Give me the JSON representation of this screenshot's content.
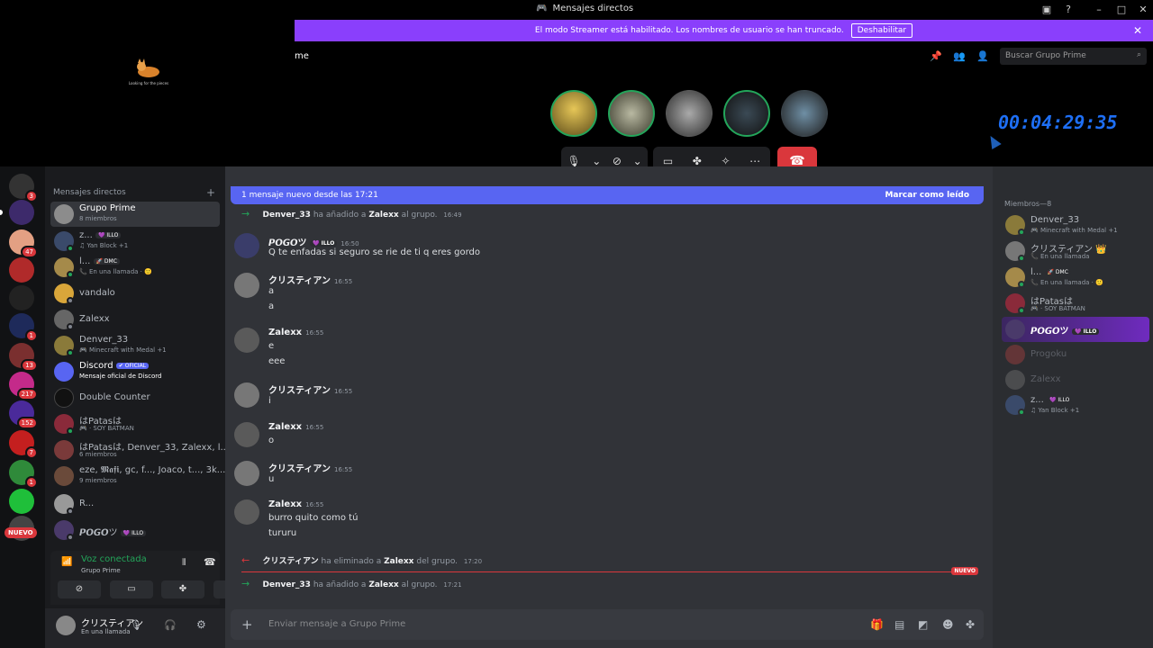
{
  "window": {
    "title": "Mensajes directos",
    "discord_icon": "discord-icon"
  },
  "banner": {
    "text": "El modo Streamer está habilitado. Los nombres de usuario se han truncado.",
    "button": "Deshabilitar"
  },
  "header": {
    "name": "me",
    "search_placeholder": "Buscar Grupo Prime"
  },
  "overlay": {
    "caption": "Looking for the pieces"
  },
  "call": {
    "timer": "00:04:29:35"
  },
  "rail": {
    "badges": [
      "3",
      "47",
      "1",
      "13",
      "217",
      "152",
      "7",
      "1"
    ],
    "new_label": "NUEVO"
  },
  "dm_sidebar": {
    "header": "Mensajes directos",
    "items": [
      {
        "name": "Grupo Prime",
        "sub": "8 miembros"
      },
      {
        "name": "z...",
        "tag": "💜 ILLO",
        "sub": "♫ Yan Block +1"
      },
      {
        "name": "l...",
        "tag": "🚀 DMC",
        "sub": "📞 En una llamada · 🙂"
      },
      {
        "name": "vandalo",
        "sub": ""
      },
      {
        "name": "Zalexx",
        "sub": ""
      },
      {
        "name": "Denver_33",
        "sub": "🎮 Minecraft with Medal +1"
      },
      {
        "name": "Discord",
        "tag": "✔ OFICIAL",
        "sub": "Mensaje oficial de Discord"
      },
      {
        "name": "Double Counter",
        "sub": ""
      },
      {
        "name": "はPatasは",
        "sub": "🎮 · SOY BATMAN"
      },
      {
        "name": "はPatasは, Denver_33, Zalexx, l...",
        "sub": "6 miembros"
      },
      {
        "name": "eze, 𝕸𝖆𝖋𝖎, gc, f..., Joaco, t..., 3k...",
        "sub": "9 miembros"
      },
      {
        "name": "R...",
        "sub": ""
      },
      {
        "name": "𝙋𝙊𝙂𝙊ツ",
        "tag": "💜 ILLO",
        "sub": ""
      }
    ],
    "voice": {
      "title": "Voz conectada",
      "channel": "Grupo Prime"
    },
    "user": {
      "name": "クリスティアン",
      "status": "En una llamada"
    }
  },
  "chat": {
    "new_messages": "1 mensaje nuevo desde las 17:21",
    "mark_read": "Marcar como leído",
    "sys1": {
      "actor": "Denver_33",
      "action": "ha añadido a",
      "target": "Zalexx",
      "end": "al grupo.",
      "time": "16:49"
    },
    "messages": [
      {
        "author": "𝙋𝙊𝙂𝙊ツ",
        "tag": "💜 ILLO",
        "time": "16:50",
        "lines": [
          "Q te enfadas si seguro se rie de ti q eres gordo"
        ]
      },
      {
        "author": "クリスティアン",
        "time": "16:55",
        "lines": [
          "a",
          "a"
        ]
      },
      {
        "author": "Zalexx",
        "time": "16:55",
        "lines": [
          "e",
          "eee"
        ]
      },
      {
        "author": "クリスティアン",
        "time": "16:55",
        "lines": [
          "i"
        ]
      },
      {
        "author": "Zalexx",
        "time": "16:55",
        "lines": [
          "o"
        ]
      },
      {
        "author": "クリスティアン",
        "time": "16:55",
        "lines": [
          "u"
        ]
      },
      {
        "author": "Zalexx",
        "time": "16:55",
        "lines": [
          "burro quito como tú",
          "tururu"
        ]
      }
    ],
    "sys2": {
      "actor": "クリスティアン",
      "action": "ha eliminado a",
      "target": "Zalexx",
      "end": "del grupo.",
      "time": "17:20"
    },
    "new_divider": "NUEVO",
    "sys3": {
      "actor": "Denver_33",
      "action": "ha añadido a",
      "target": "Zalexx",
      "end": "al grupo.",
      "time": "17:21"
    },
    "composer_placeholder": "Enviar mensaje a Grupo Prime"
  },
  "members": {
    "header": "Miembros—8",
    "items": [
      {
        "name": "Denver_33",
        "sub": "🎮 Minecraft with Medal +1"
      },
      {
        "name": "クリスティアン 👑",
        "sub": "📞 En una llamada"
      },
      {
        "name": "l...",
        "tag": "🚀 DMC",
        "sub": "📞 En una llamada · 🙂"
      },
      {
        "name": "はPatasは",
        "sub": "🎮 · SOY BATMAN"
      },
      {
        "name": "𝙋𝙊𝙂𝙊ツ",
        "tag": "💜 ILLO",
        "sub": ""
      },
      {
        "name": "Progoku",
        "sub": ""
      },
      {
        "name": "Zalexx",
        "sub": ""
      },
      {
        "name": "z...",
        "tag": "💜 ILLO",
        "sub": "♫ Yan Block +1"
      }
    ]
  }
}
